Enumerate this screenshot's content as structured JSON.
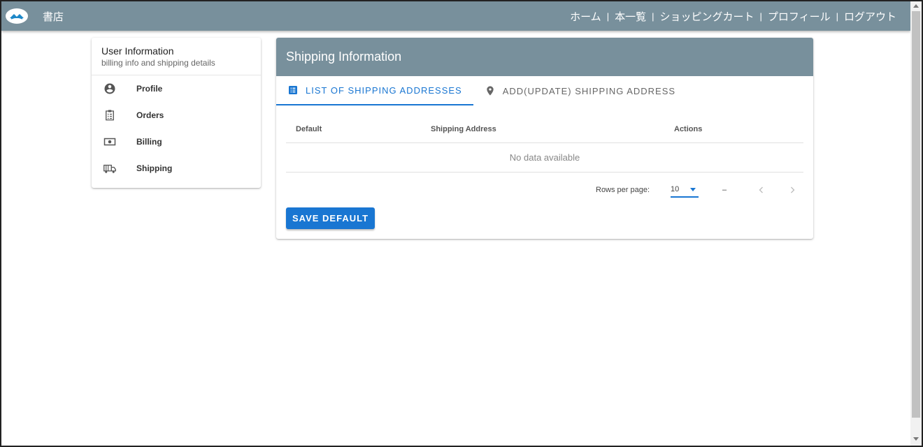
{
  "app": {
    "brand": "書店"
  },
  "nav": {
    "items": [
      "ホーム",
      "本一覧",
      "ショッピングカート",
      "プロフィール",
      "ログアウト"
    ],
    "separator": "|"
  },
  "sidebar": {
    "title": "User Information",
    "subtitle": "billing info and shipping details",
    "items": [
      {
        "label": "Profile",
        "icon": "account-circle-icon"
      },
      {
        "label": "Orders",
        "icon": "clipboard-list-icon"
      },
      {
        "label": "Billing",
        "icon": "cash-icon"
      },
      {
        "label": "Shipping",
        "icon": "truck-icon"
      }
    ]
  },
  "main": {
    "title": "Shipping Information",
    "tabs": [
      {
        "label": "List of shipping addresses",
        "icon": "list-icon",
        "active": true
      },
      {
        "label": "Add(Update) shipping address",
        "icon": "map-marker-icon",
        "active": false
      }
    ],
    "table": {
      "headers": [
        "Default",
        "Shipping Address",
        "Actions"
      ],
      "empty_text": "No data available",
      "rows_per_page_label": "Rows per page:",
      "rows_per_page_value": "10",
      "range_text": "–"
    },
    "save_button": "Save Default"
  },
  "colors": {
    "header": "#78909c",
    "accent": "#1976d2"
  }
}
